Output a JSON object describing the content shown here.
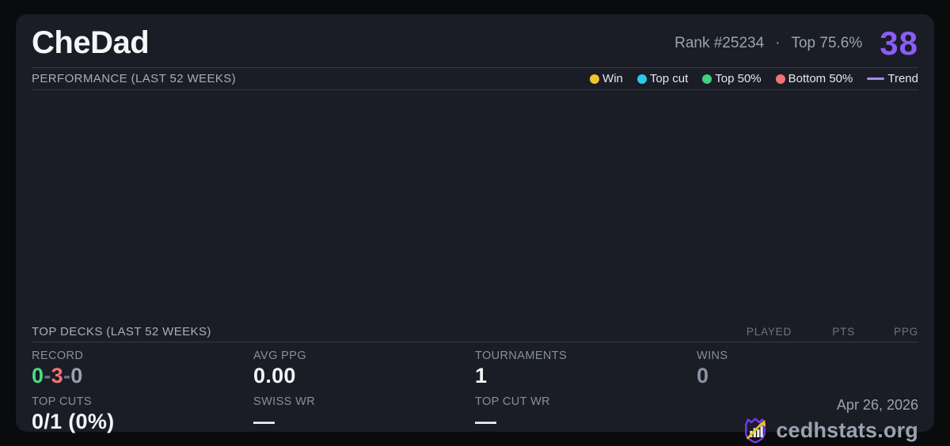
{
  "header": {
    "player_name": "CheDad",
    "rank": "Rank #25234",
    "dot_separator": "·",
    "top_percent": "Top 75.6%",
    "score": "38"
  },
  "performance": {
    "title": "PERFORMANCE (LAST 52 WEEKS)",
    "legend": {
      "win": {
        "label": "Win",
        "color": "#f0c42e"
      },
      "top_cut": {
        "label": "Top cut",
        "color": "#2ec9ea"
      },
      "top_50": {
        "label": "Top 50%",
        "color": "#41d07e"
      },
      "bottom_50": {
        "label": "Bottom 50%",
        "color": "#f47174"
      },
      "trend": {
        "label": "Trend",
        "color": "#a78bfa"
      }
    }
  },
  "chart_data": {
    "type": "scatter",
    "title": "PERFORMANCE (LAST 52 WEEKS)",
    "series": [
      {
        "name": "Win",
        "color": "#f0c42e",
        "points": []
      },
      {
        "name": "Top cut",
        "color": "#2ec9ea",
        "points": []
      },
      {
        "name": "Top 50%",
        "color": "#41d07e",
        "points": []
      },
      {
        "name": "Bottom 50%",
        "color": "#f47174",
        "points": []
      },
      {
        "name": "Trend",
        "color": "#a78bfa",
        "points": []
      }
    ],
    "axes_visible": false,
    "grid": false,
    "note": "chart plot area is rendered empty - no data points, ticks or gridlines visible"
  },
  "top_decks": {
    "title": "TOP DECKS (LAST 52 WEEKS)",
    "columns": {
      "played": "PLAYED",
      "pts": "PTS",
      "ppg": "PPG"
    },
    "rows": []
  },
  "stats": {
    "record": {
      "label": "RECORD",
      "wins": "0",
      "sep1": "-",
      "losses": "3",
      "sep2": "-",
      "draws": "0"
    },
    "avg_ppg": {
      "label": "AVG PPG",
      "value": "0.00"
    },
    "tournaments": {
      "label": "TOURNAMENTS",
      "value": "1"
    },
    "wins": {
      "label": "WINS",
      "value": "0"
    },
    "top_cuts": {
      "label": "TOP CUTS",
      "value": "0/1 (0%)"
    },
    "swiss_wr": {
      "label": "SWISS WR",
      "value": "—"
    },
    "top_cut_wr": {
      "label": "TOP CUT WR",
      "value": "—"
    }
  },
  "footer": {
    "date": "Apr 26, 2026",
    "site_name": "cedhstats.org"
  },
  "colors": {
    "page_background": "#0a0b0d",
    "card_background": "#1a1d26",
    "divider": "#333947",
    "accent_purple": "#8b5cf6",
    "record_win_green": "#4ade80",
    "record_loss_red": "#f47174",
    "logo_purple": "#7c3aed",
    "logo_gold": "#ecbf2a"
  }
}
